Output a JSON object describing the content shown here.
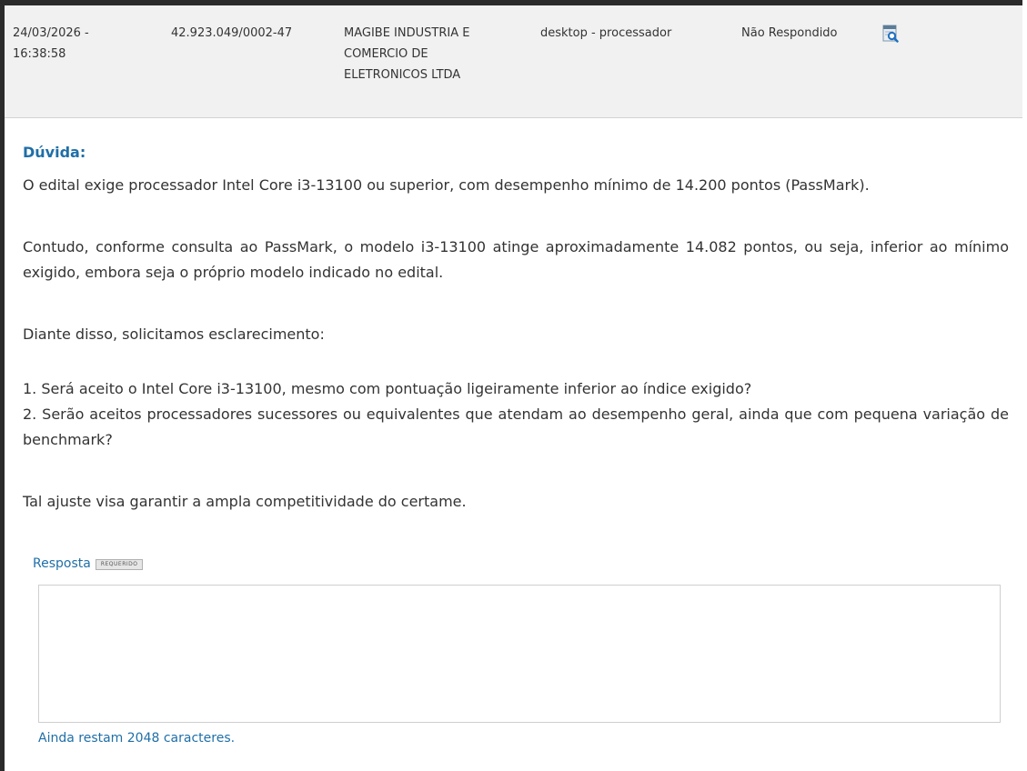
{
  "header": {
    "date_line1": "24/03/2026 -",
    "date_line2": "16:38:58",
    "cnpj": "42.923.049/0002-47",
    "company_line1": "MAGIBE INDUSTRIA E",
    "company_line2": "COMERCIO DE",
    "company_line3": "ELETRONICOS LTDA",
    "item": "desktop - processador",
    "status": "Não Respondido",
    "view_icon": "magnifier-document-icon"
  },
  "question": {
    "title": "Dúvida:",
    "p1": "O edital exige processador Intel Core i3-13100 ou superior, com desempenho mínimo de 14.200 pontos (PassMark).",
    "p2": "Contudo, conforme consulta ao PassMark, o modelo i3-13100 atinge aproximadamente 14.082 pontos, ou seja, inferior ao mínimo exigido, embora seja o próprio modelo indicado no edital.",
    "p3": "Diante disso, solicitamos esclarecimento:",
    "p4": "1. Será aceito o Intel Core i3-13100, mesmo com pontuação ligeiramente inferior ao índice exigido?",
    "p5": "2. Serão aceitos processadores sucessores ou equivalentes que atendam ao desempenho geral, ainda que com pequena variação de benchmark?",
    "p6": "Tal ajuste visa garantir a ampla competitividade do certame."
  },
  "response": {
    "label": "Resposta",
    "badge": "REQUERIDO",
    "value": "",
    "counter": "Ainda restam 2048 caracteres."
  },
  "colors": {
    "accent": "#1f6fa8",
    "header_bg": "#f1f1f1",
    "frame": "#2b2b2b"
  }
}
